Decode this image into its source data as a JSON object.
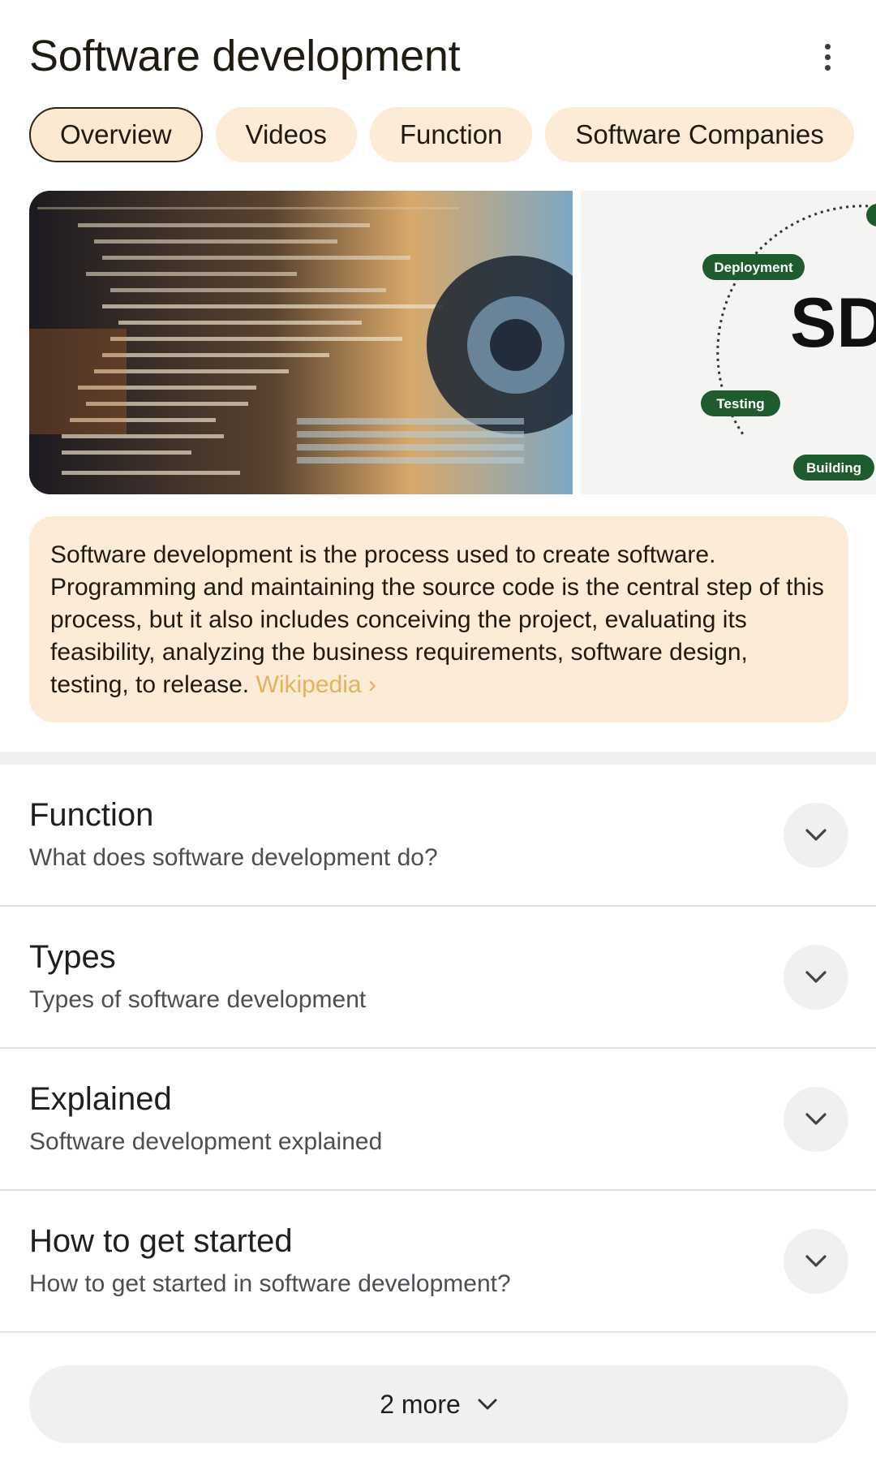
{
  "header": {
    "title": "Software development"
  },
  "tabs": [
    {
      "label": "Overview",
      "active": true
    },
    {
      "label": "Videos"
    },
    {
      "label": "Function"
    },
    {
      "label": "Software Companies"
    }
  ],
  "images": {
    "diagram_labels": [
      "Deployment",
      "SDI",
      "Testing",
      "Building"
    ]
  },
  "description": {
    "text": "Software development is the process used to create software. Programming and maintaining the source code is the central step of this process, but it also includes conceiving the project, evaluating its feasibility, analyzing the business requirements, software design, testing, to release.",
    "source": "Wikipedia",
    "source_chevron": "›"
  },
  "accordions": [
    {
      "title": "Function",
      "subtitle": "What does software development do?"
    },
    {
      "title": "Types",
      "subtitle": "Types of software development"
    },
    {
      "title": "Explained",
      "subtitle": "Software development explained"
    },
    {
      "title": "How to get started",
      "subtitle": "How to get started in software development?"
    }
  ],
  "more_button": {
    "label": "2 more"
  },
  "colors": {
    "chip_bg": "#fcebd6",
    "link": "#e3b25a",
    "accent_green": "#1e5b2e"
  }
}
